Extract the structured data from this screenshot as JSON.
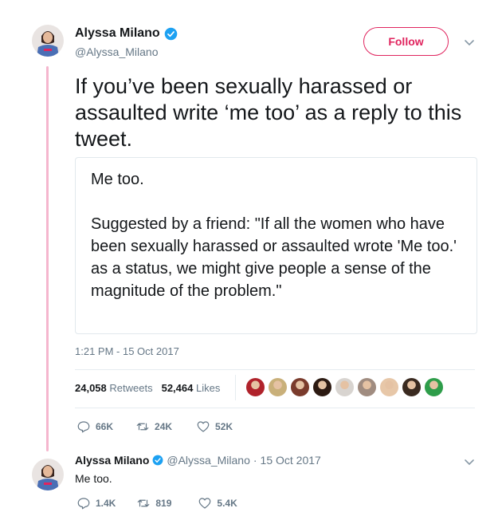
{
  "tweet": {
    "author_name": "Alyssa Milano",
    "author_handle": "@Alyssa_Milano",
    "follow_label": "Follow",
    "text": "If you’ve been sexually harassed or assaulted write ‘me too’ as a reply to this tweet.",
    "quote_line1": "Me too.",
    "quote_line2": "Suggested by a friend: \"If all the women who have been sexually harassed or assaulted wrote 'Me too.' as a status, we might give people a sense of the magnitude of the problem.\"",
    "timestamp": "1:21 PM - 15 Oct 2017",
    "retweets_count": "24,058",
    "retweets_label": "Retweets",
    "likes_count": "52,464",
    "likes_label": "Likes",
    "reply_count": "66K",
    "retweet_count_short": "24K",
    "like_count_short": "52K"
  },
  "reply": {
    "author_name": "Alyssa Milano",
    "author_handle": "@Alyssa_Milano",
    "separator": "·",
    "date": "15 Oct 2017",
    "text": "Me too.",
    "reply_count": "1.4K",
    "retweet_count": "819",
    "like_count": "5.4K"
  },
  "colors": {
    "accent": "#e0245e",
    "verified": "#1da1f2",
    "thread_line": "#f5b6ce",
    "muted": "#657786"
  },
  "liker_avatars": [
    {
      "color": "#b0222b"
    },
    {
      "color": "#c9b07a"
    },
    {
      "color": "#7a3b2c"
    },
    {
      "color": "#2c1a12"
    },
    {
      "color": "#d8d4d0"
    },
    {
      "color": "#a08c80"
    },
    {
      "color": "#e7c7a8"
    },
    {
      "color": "#3a2a20"
    },
    {
      "color": "#2e9d4a"
    }
  ]
}
